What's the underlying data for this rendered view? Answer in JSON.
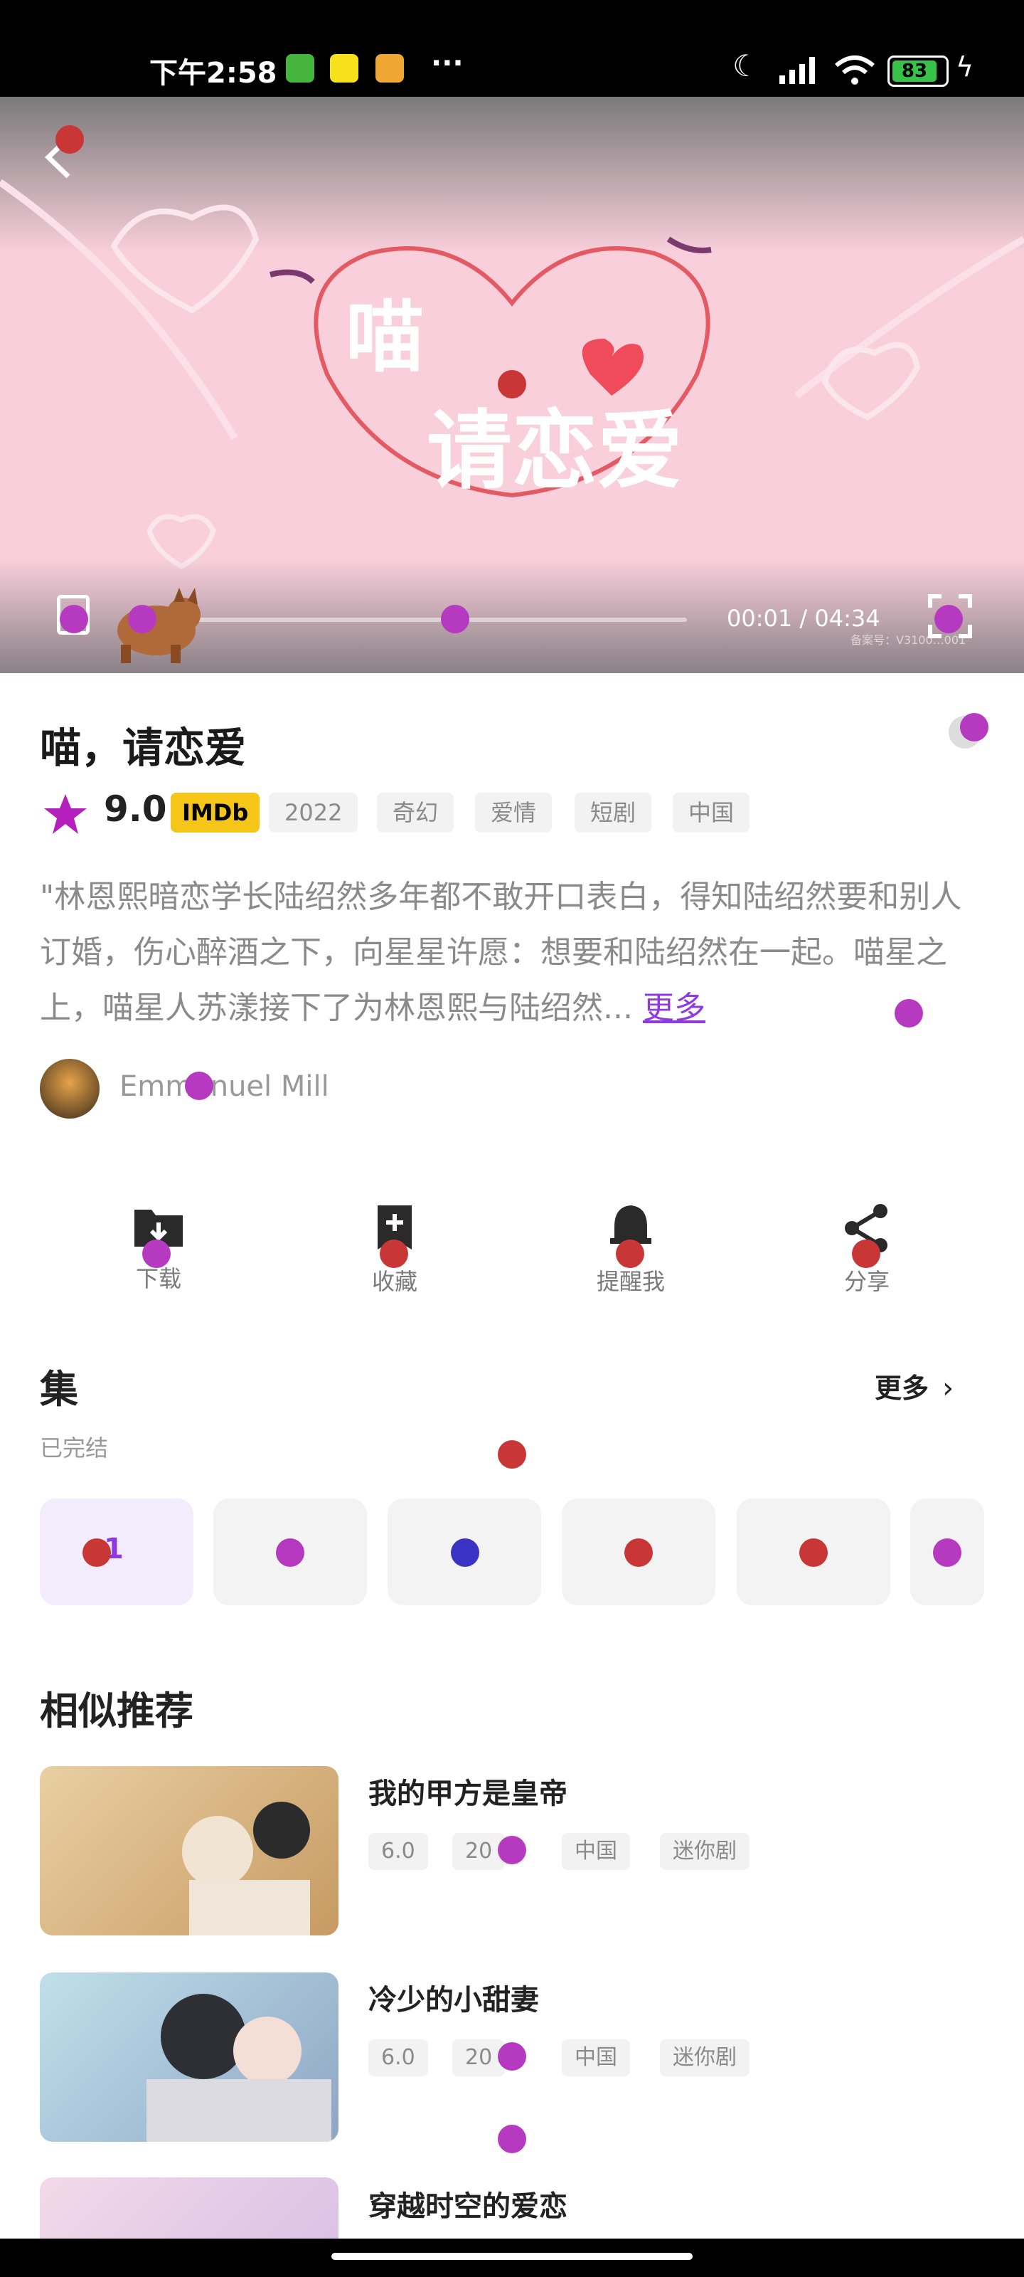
{
  "status": {
    "time": "下午2:58",
    "battery": "83"
  },
  "video": {
    "title_line1": "喵",
    "title_line2": "请恋爱",
    "time": "00:01 / 04:34",
    "watermark": "备案号：V3100…001"
  },
  "show": {
    "title": "喵，请恋爱",
    "rating": "9.0",
    "imdb": "IMDb",
    "tags": [
      "2022",
      "奇幻",
      "爱情",
      "短剧",
      "中国"
    ],
    "description": "\"林恩熙暗恋学长陆绍然多年都不敢开口表白，得知陆绍然要和别人订婚，伤心醉酒之下，向星星许愿：想要和陆绍然在一起。喵星之上，喵星人苏漾接下了为林恩熙与陆绍然...",
    "more": "更多",
    "author": "Emmanuel Mill"
  },
  "actions": [
    {
      "label": "下载",
      "icon": "download-folder-icon"
    },
    {
      "label": "收藏",
      "icon": "bookmark-add-icon"
    },
    {
      "label": "提醒我",
      "icon": "bell-icon"
    },
    {
      "label": "分享",
      "icon": "share-icon"
    }
  ],
  "episodes": {
    "title": "集",
    "status": "已完结",
    "more": "更多",
    "items": [
      "1",
      "",
      "",
      "",
      "",
      ""
    ]
  },
  "recommend": {
    "title": "相似推荐",
    "items": [
      {
        "title": "我的甲方是皇帝",
        "tags": [
          "6.0",
          "20",
          "中国",
          "迷你剧"
        ]
      },
      {
        "title": "冷少的小甜妻",
        "tags": [
          "6.0",
          "20",
          "中国",
          "迷你剧"
        ]
      },
      {
        "title": "穿越时空的爱恋",
        "tags": []
      }
    ]
  },
  "colors": {
    "accent": "#8e3ae0",
    "rating": "#b41fbe",
    "imdb": "#f5c518"
  }
}
